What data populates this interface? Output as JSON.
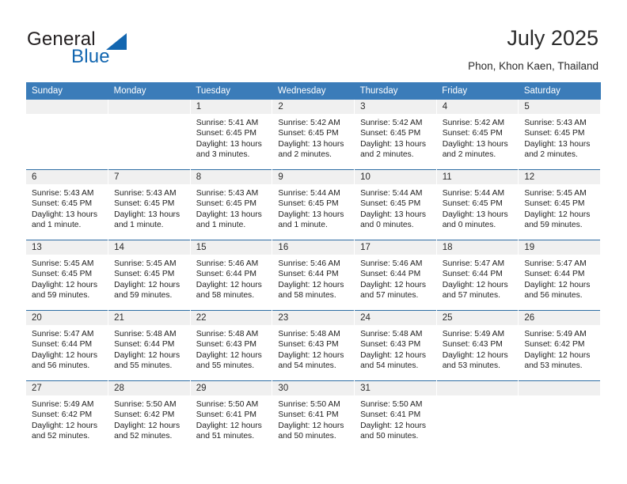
{
  "logo": {
    "word_one": "General",
    "word_two": "Blue",
    "icon": "triangle-mark"
  },
  "header": {
    "title": "July 2025",
    "subtitle": "Phon, Khon Kaen, Thailand"
  },
  "calendar": {
    "weekday_headers": [
      "Sunday",
      "Monday",
      "Tuesday",
      "Wednesday",
      "Thursday",
      "Friday",
      "Saturday"
    ],
    "labels": {
      "sunrise_prefix": "Sunrise:",
      "sunset_prefix": "Sunset:",
      "daylight_prefix": "Daylight:"
    },
    "colors": {
      "header_blue": "#3b7cb9",
      "row_divider_blue": "#2e6da4",
      "daynum_band": "#f0f0f0",
      "logo_blue": "#1266b0",
      "text": "#222222"
    },
    "weeks": [
      [
        {
          "day": "",
          "sunrise": "",
          "sunset": "",
          "daylight": ""
        },
        {
          "day": "",
          "sunrise": "",
          "sunset": "",
          "daylight": ""
        },
        {
          "day": "1",
          "sunrise": "Sunrise: 5:41 AM",
          "sunset": "Sunset: 6:45 PM",
          "daylight": "Daylight: 13 hours and 3 minutes."
        },
        {
          "day": "2",
          "sunrise": "Sunrise: 5:42 AM",
          "sunset": "Sunset: 6:45 PM",
          "daylight": "Daylight: 13 hours and 2 minutes."
        },
        {
          "day": "3",
          "sunrise": "Sunrise: 5:42 AM",
          "sunset": "Sunset: 6:45 PM",
          "daylight": "Daylight: 13 hours and 2 minutes."
        },
        {
          "day": "4",
          "sunrise": "Sunrise: 5:42 AM",
          "sunset": "Sunset: 6:45 PM",
          "daylight": "Daylight: 13 hours and 2 minutes."
        },
        {
          "day": "5",
          "sunrise": "Sunrise: 5:43 AM",
          "sunset": "Sunset: 6:45 PM",
          "daylight": "Daylight: 13 hours and 2 minutes."
        }
      ],
      [
        {
          "day": "6",
          "sunrise": "Sunrise: 5:43 AM",
          "sunset": "Sunset: 6:45 PM",
          "daylight": "Daylight: 13 hours and 1 minute."
        },
        {
          "day": "7",
          "sunrise": "Sunrise: 5:43 AM",
          "sunset": "Sunset: 6:45 PM",
          "daylight": "Daylight: 13 hours and 1 minute."
        },
        {
          "day": "8",
          "sunrise": "Sunrise: 5:43 AM",
          "sunset": "Sunset: 6:45 PM",
          "daylight": "Daylight: 13 hours and 1 minute."
        },
        {
          "day": "9",
          "sunrise": "Sunrise: 5:44 AM",
          "sunset": "Sunset: 6:45 PM",
          "daylight": "Daylight: 13 hours and 1 minute."
        },
        {
          "day": "10",
          "sunrise": "Sunrise: 5:44 AM",
          "sunset": "Sunset: 6:45 PM",
          "daylight": "Daylight: 13 hours and 0 minutes."
        },
        {
          "day": "11",
          "sunrise": "Sunrise: 5:44 AM",
          "sunset": "Sunset: 6:45 PM",
          "daylight": "Daylight: 13 hours and 0 minutes."
        },
        {
          "day": "12",
          "sunrise": "Sunrise: 5:45 AM",
          "sunset": "Sunset: 6:45 PM",
          "daylight": "Daylight: 12 hours and 59 minutes."
        }
      ],
      [
        {
          "day": "13",
          "sunrise": "Sunrise: 5:45 AM",
          "sunset": "Sunset: 6:45 PM",
          "daylight": "Daylight: 12 hours and 59 minutes."
        },
        {
          "day": "14",
          "sunrise": "Sunrise: 5:45 AM",
          "sunset": "Sunset: 6:45 PM",
          "daylight": "Daylight: 12 hours and 59 minutes."
        },
        {
          "day": "15",
          "sunrise": "Sunrise: 5:46 AM",
          "sunset": "Sunset: 6:44 PM",
          "daylight": "Daylight: 12 hours and 58 minutes."
        },
        {
          "day": "16",
          "sunrise": "Sunrise: 5:46 AM",
          "sunset": "Sunset: 6:44 PM",
          "daylight": "Daylight: 12 hours and 58 minutes."
        },
        {
          "day": "17",
          "sunrise": "Sunrise: 5:46 AM",
          "sunset": "Sunset: 6:44 PM",
          "daylight": "Daylight: 12 hours and 57 minutes."
        },
        {
          "day": "18",
          "sunrise": "Sunrise: 5:47 AM",
          "sunset": "Sunset: 6:44 PM",
          "daylight": "Daylight: 12 hours and 57 minutes."
        },
        {
          "day": "19",
          "sunrise": "Sunrise: 5:47 AM",
          "sunset": "Sunset: 6:44 PM",
          "daylight": "Daylight: 12 hours and 56 minutes."
        }
      ],
      [
        {
          "day": "20",
          "sunrise": "Sunrise: 5:47 AM",
          "sunset": "Sunset: 6:44 PM",
          "daylight": "Daylight: 12 hours and 56 minutes."
        },
        {
          "day": "21",
          "sunrise": "Sunrise: 5:48 AM",
          "sunset": "Sunset: 6:44 PM",
          "daylight": "Daylight: 12 hours and 55 minutes."
        },
        {
          "day": "22",
          "sunrise": "Sunrise: 5:48 AM",
          "sunset": "Sunset: 6:43 PM",
          "daylight": "Daylight: 12 hours and 55 minutes."
        },
        {
          "day": "23",
          "sunrise": "Sunrise: 5:48 AM",
          "sunset": "Sunset: 6:43 PM",
          "daylight": "Daylight: 12 hours and 54 minutes."
        },
        {
          "day": "24",
          "sunrise": "Sunrise: 5:48 AM",
          "sunset": "Sunset: 6:43 PM",
          "daylight": "Daylight: 12 hours and 54 minutes."
        },
        {
          "day": "25",
          "sunrise": "Sunrise: 5:49 AM",
          "sunset": "Sunset: 6:43 PM",
          "daylight": "Daylight: 12 hours and 53 minutes."
        },
        {
          "day": "26",
          "sunrise": "Sunrise: 5:49 AM",
          "sunset": "Sunset: 6:42 PM",
          "daylight": "Daylight: 12 hours and 53 minutes."
        }
      ],
      [
        {
          "day": "27",
          "sunrise": "Sunrise: 5:49 AM",
          "sunset": "Sunset: 6:42 PM",
          "daylight": "Daylight: 12 hours and 52 minutes."
        },
        {
          "day": "28",
          "sunrise": "Sunrise: 5:50 AM",
          "sunset": "Sunset: 6:42 PM",
          "daylight": "Daylight: 12 hours and 52 minutes."
        },
        {
          "day": "29",
          "sunrise": "Sunrise: 5:50 AM",
          "sunset": "Sunset: 6:41 PM",
          "daylight": "Daylight: 12 hours and 51 minutes."
        },
        {
          "day": "30",
          "sunrise": "Sunrise: 5:50 AM",
          "sunset": "Sunset: 6:41 PM",
          "daylight": "Daylight: 12 hours and 50 minutes."
        },
        {
          "day": "31",
          "sunrise": "Sunrise: 5:50 AM",
          "sunset": "Sunset: 6:41 PM",
          "daylight": "Daylight: 12 hours and 50 minutes."
        },
        {
          "day": "",
          "sunrise": "",
          "sunset": "",
          "daylight": ""
        },
        {
          "day": "",
          "sunrise": "",
          "sunset": "",
          "daylight": ""
        }
      ]
    ]
  }
}
